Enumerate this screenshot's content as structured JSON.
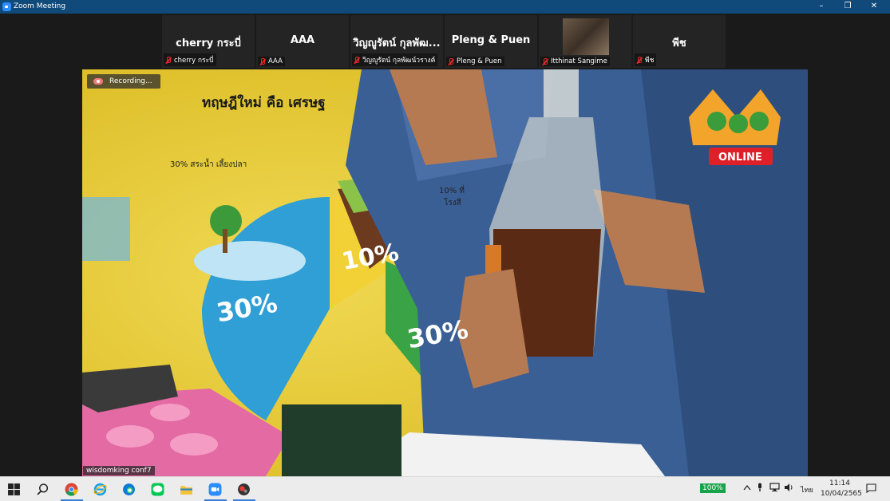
{
  "window": {
    "title": "Zoom Meeting",
    "controls": [
      "–",
      "❐",
      "✕"
    ]
  },
  "participants": [
    {
      "display": "cherry กระบี่",
      "label": "cherry กระบี่",
      "muted": true
    },
    {
      "display": "AAA",
      "label": "AAA",
      "muted": true
    },
    {
      "display": "วิญญูรัตน์ กุลพัฒ...",
      "label": "วิญญูรัตน์ กุลพัฒน์วรางค์",
      "muted": true
    },
    {
      "display": "Pleng & Puen",
      "label": "Pleng & Puen",
      "muted": true
    },
    {
      "display": "",
      "label": "Itthinat Sangime",
      "muted": true,
      "has_video": true
    },
    {
      "display": "พีช",
      "label": "พีช",
      "muted": true
    }
  ],
  "recording": {
    "label": "Recording..."
  },
  "active_speaker": {
    "name": "wisdomking conf7"
  },
  "poster": {
    "headline": "ทฤษฎีใหม่ คือ เศรษฐ",
    "caption_left": "30% สระน้ำ เลี้ยงปลา",
    "caption_right": "10% ที่",
    "caption_right2": "โรงสี",
    "pct_a": "10%",
    "pct_b": "30%",
    "pct_c": "30%"
  },
  "logo_badge": {
    "text": "ONLINE"
  },
  "taskbar": {
    "battery": "100%",
    "language": "ไทย",
    "time": "11:14",
    "date": "10/04/2565"
  },
  "colors": {
    "titlebar": "#0f4a7a",
    "poster_yellow": "#e6c82e",
    "zoom_blue": "#2d8cff",
    "online_red": "#e02028"
  }
}
